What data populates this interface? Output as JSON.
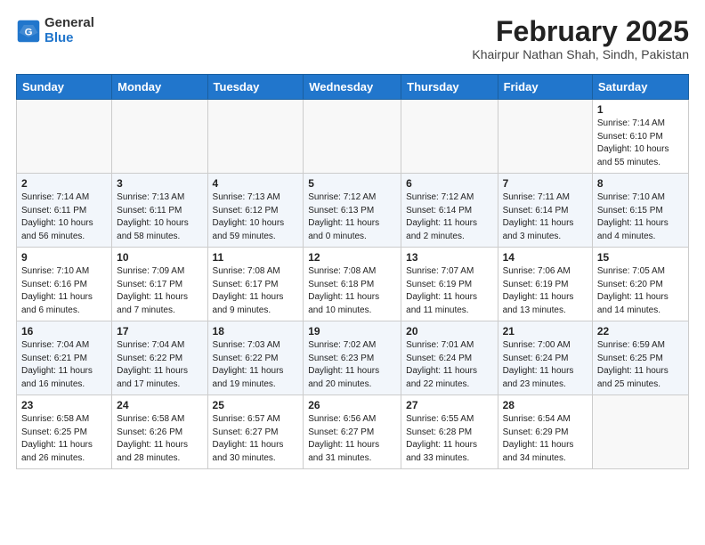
{
  "header": {
    "logo_general": "General",
    "logo_blue": "Blue",
    "month_title": "February 2025",
    "location": "Khairpur Nathan Shah, Sindh, Pakistan"
  },
  "weekdays": [
    "Sunday",
    "Monday",
    "Tuesday",
    "Wednesday",
    "Thursday",
    "Friday",
    "Saturday"
  ],
  "weeks": [
    [
      {
        "day": "",
        "info": ""
      },
      {
        "day": "",
        "info": ""
      },
      {
        "day": "",
        "info": ""
      },
      {
        "day": "",
        "info": ""
      },
      {
        "day": "",
        "info": ""
      },
      {
        "day": "",
        "info": ""
      },
      {
        "day": "1",
        "info": "Sunrise: 7:14 AM\nSunset: 6:10 PM\nDaylight: 10 hours\nand 55 minutes."
      }
    ],
    [
      {
        "day": "2",
        "info": "Sunrise: 7:14 AM\nSunset: 6:11 PM\nDaylight: 10 hours\nand 56 minutes."
      },
      {
        "day": "3",
        "info": "Sunrise: 7:13 AM\nSunset: 6:11 PM\nDaylight: 10 hours\nand 58 minutes."
      },
      {
        "day": "4",
        "info": "Sunrise: 7:13 AM\nSunset: 6:12 PM\nDaylight: 10 hours\nand 59 minutes."
      },
      {
        "day": "5",
        "info": "Sunrise: 7:12 AM\nSunset: 6:13 PM\nDaylight: 11 hours\nand 0 minutes."
      },
      {
        "day": "6",
        "info": "Sunrise: 7:12 AM\nSunset: 6:14 PM\nDaylight: 11 hours\nand 2 minutes."
      },
      {
        "day": "7",
        "info": "Sunrise: 7:11 AM\nSunset: 6:14 PM\nDaylight: 11 hours\nand 3 minutes."
      },
      {
        "day": "8",
        "info": "Sunrise: 7:10 AM\nSunset: 6:15 PM\nDaylight: 11 hours\nand 4 minutes."
      }
    ],
    [
      {
        "day": "9",
        "info": "Sunrise: 7:10 AM\nSunset: 6:16 PM\nDaylight: 11 hours\nand 6 minutes."
      },
      {
        "day": "10",
        "info": "Sunrise: 7:09 AM\nSunset: 6:17 PM\nDaylight: 11 hours\nand 7 minutes."
      },
      {
        "day": "11",
        "info": "Sunrise: 7:08 AM\nSunset: 6:17 PM\nDaylight: 11 hours\nand 9 minutes."
      },
      {
        "day": "12",
        "info": "Sunrise: 7:08 AM\nSunset: 6:18 PM\nDaylight: 11 hours\nand 10 minutes."
      },
      {
        "day": "13",
        "info": "Sunrise: 7:07 AM\nSunset: 6:19 PM\nDaylight: 11 hours\nand 11 minutes."
      },
      {
        "day": "14",
        "info": "Sunrise: 7:06 AM\nSunset: 6:19 PM\nDaylight: 11 hours\nand 13 minutes."
      },
      {
        "day": "15",
        "info": "Sunrise: 7:05 AM\nSunset: 6:20 PM\nDaylight: 11 hours\nand 14 minutes."
      }
    ],
    [
      {
        "day": "16",
        "info": "Sunrise: 7:04 AM\nSunset: 6:21 PM\nDaylight: 11 hours\nand 16 minutes."
      },
      {
        "day": "17",
        "info": "Sunrise: 7:04 AM\nSunset: 6:22 PM\nDaylight: 11 hours\nand 17 minutes."
      },
      {
        "day": "18",
        "info": "Sunrise: 7:03 AM\nSunset: 6:22 PM\nDaylight: 11 hours\nand 19 minutes."
      },
      {
        "day": "19",
        "info": "Sunrise: 7:02 AM\nSunset: 6:23 PM\nDaylight: 11 hours\nand 20 minutes."
      },
      {
        "day": "20",
        "info": "Sunrise: 7:01 AM\nSunset: 6:24 PM\nDaylight: 11 hours\nand 22 minutes."
      },
      {
        "day": "21",
        "info": "Sunrise: 7:00 AM\nSunset: 6:24 PM\nDaylight: 11 hours\nand 23 minutes."
      },
      {
        "day": "22",
        "info": "Sunrise: 6:59 AM\nSunset: 6:25 PM\nDaylight: 11 hours\nand 25 minutes."
      }
    ],
    [
      {
        "day": "23",
        "info": "Sunrise: 6:58 AM\nSunset: 6:25 PM\nDaylight: 11 hours\nand 26 minutes."
      },
      {
        "day": "24",
        "info": "Sunrise: 6:58 AM\nSunset: 6:26 PM\nDaylight: 11 hours\nand 28 minutes."
      },
      {
        "day": "25",
        "info": "Sunrise: 6:57 AM\nSunset: 6:27 PM\nDaylight: 11 hours\nand 30 minutes."
      },
      {
        "day": "26",
        "info": "Sunrise: 6:56 AM\nSunset: 6:27 PM\nDaylight: 11 hours\nand 31 minutes."
      },
      {
        "day": "27",
        "info": "Sunrise: 6:55 AM\nSunset: 6:28 PM\nDaylight: 11 hours\nand 33 minutes."
      },
      {
        "day": "28",
        "info": "Sunrise: 6:54 AM\nSunset: 6:29 PM\nDaylight: 11 hours\nand 34 minutes."
      },
      {
        "day": "",
        "info": ""
      }
    ]
  ]
}
